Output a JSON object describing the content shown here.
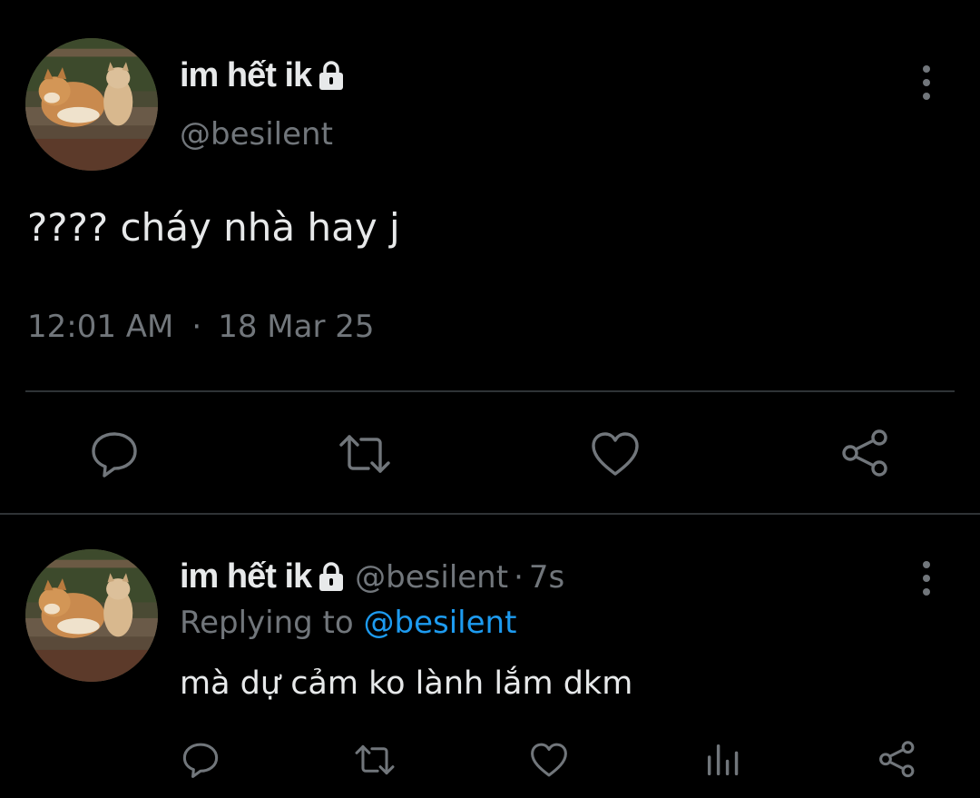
{
  "tweet": {
    "author": {
      "display_name": "im hết ik",
      "handle": "@besilent",
      "protected": true,
      "avatar": "shiba-and-cat-on-bench"
    },
    "text": "???? cháy nhà hay j",
    "time": "12:01 AM",
    "separator": "·",
    "date": "18 Mar 25",
    "actions": [
      "reply-icon",
      "retweet-icon",
      "like-icon",
      "share-icon"
    ]
  },
  "reply": {
    "author": {
      "display_name": "im hết ik",
      "handle": "@besilent",
      "protected": true,
      "avatar": "shiba-and-cat-on-bench"
    },
    "dot": "·",
    "time": "7s",
    "replying_prefix": "Replying to ",
    "replying_to": "@besilent",
    "text": "mà dự cảm ko lành lắm dkm",
    "actions": [
      "reply-icon",
      "retweet-icon",
      "like-icon",
      "analytics-icon",
      "share-icon"
    ]
  },
  "colors": {
    "background": "#000000",
    "text_primary": "#e7e9ea",
    "text_secondary": "#71767b",
    "accent": "#1d9bf0",
    "divider": "#2f3336"
  }
}
